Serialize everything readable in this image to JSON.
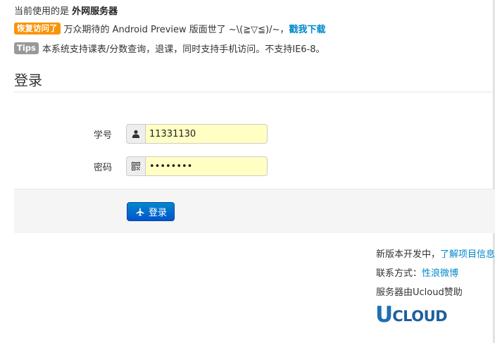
{
  "header": {
    "server_prefix": "当前使用的是",
    "server_name": "外网服务器"
  },
  "notices": [
    {
      "badge": "恢复访问了",
      "text": "万众期待的 Android Preview 版面世了 ~\\(≧▽≦)/~，",
      "link": "戳我下载"
    },
    {
      "badge": "Tips",
      "text": "本系统支持课表/分数查询，退课，同时支持手机访问。不支持IE6-8。"
    }
  ],
  "login": {
    "title": "登录",
    "username_label": "学号",
    "username_value": "11331130",
    "password_label": "密码",
    "password_value": "••••••••",
    "submit_label": "登录"
  },
  "side": {
    "dev_text": "新版本开发中，",
    "dev_link": "了解项目信息",
    "contact_text": "联系方式：",
    "contact_link": "性浪微博",
    "sponsor_text": "服务器由Ucloud赞助",
    "logo_u": "U",
    "logo_rest": "CLOUD"
  },
  "colors": {
    "badge_orange": "#f89406",
    "badge_gray": "#999999",
    "link": "#0088cc",
    "input_bg": "#ffffc4",
    "button": "#0066cc"
  }
}
